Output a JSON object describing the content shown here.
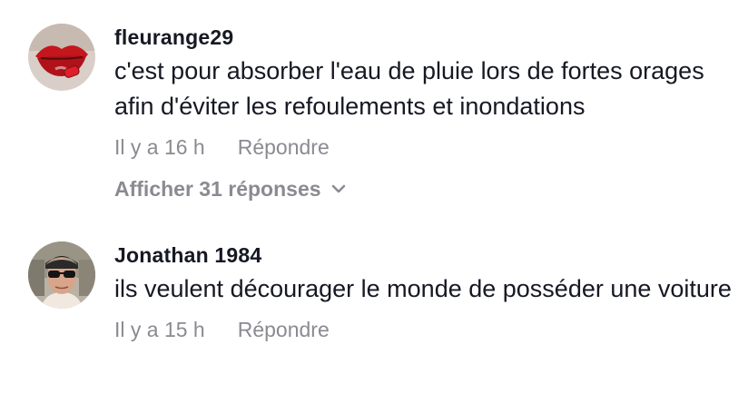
{
  "comments": [
    {
      "username": "fleurange29",
      "text": "c'est pour absorber l'eau de pluie lors de fortes orages afin d'éviter les refoulements et inondations",
      "time": "Il y a 16 h",
      "reply_label": "Répondre",
      "view_replies_label": "Afficher 31 réponses",
      "avatar_icon": "red-lips-avatar"
    },
    {
      "username": "Jonathan 1984",
      "text": "ils veulent décourager le monde de posséder une voiture",
      "time": "Il y a 15 h",
      "reply_label": "Répondre",
      "avatar_icon": "man-sunglasses-avatar"
    }
  ],
  "colors": {
    "text_primary": "#161823",
    "text_secondary": "#8a8b91"
  }
}
